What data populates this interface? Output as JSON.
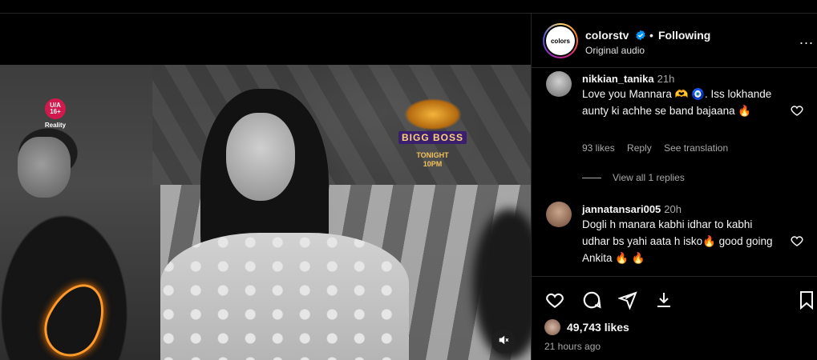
{
  "post": {
    "username": "colorstv",
    "separator": "•",
    "following_label": "Following",
    "audio_label": "Original audio",
    "avatar_text": "colors",
    "more_label": "...",
    "likes": "49,743 likes",
    "time_ago": "21 hours ago"
  },
  "video": {
    "rating_age": "U/A 16+",
    "rating_genre": "Reality",
    "show_title": "BIGG BOSS",
    "tonight": "TONIGHT",
    "air_time": "10PM",
    "muted": true
  },
  "comments": [
    {
      "username": "nikkian_tanika",
      "time": "21h",
      "text": "Love you Mannara 🫶 🧿. Iss lokhande aunty ki achhe se band bajaana 🔥",
      "likes": "93 likes",
      "reply_label": "Reply",
      "translate_label": "See translation",
      "view_replies": "View all 1 replies"
    },
    {
      "username": "jannatansari005",
      "time": "20h",
      "text": "Dogli h manara kabhi idhar to kabhi udhar bs yahi aata h isko🔥 good going Ankita 🔥 🔥"
    }
  ],
  "icons": {
    "like": "heart-icon",
    "comment": "comment-icon",
    "share": "send-icon",
    "download": "download-icon",
    "save": "bookmark-icon",
    "verified": "verified-badge-icon",
    "mute": "volume-muted-icon"
  },
  "colors": {
    "background": "#000000",
    "text": "#f5f5f5",
    "muted_text": "#a8a8a8",
    "verified": "#0095f6",
    "divider": "#262626"
  }
}
